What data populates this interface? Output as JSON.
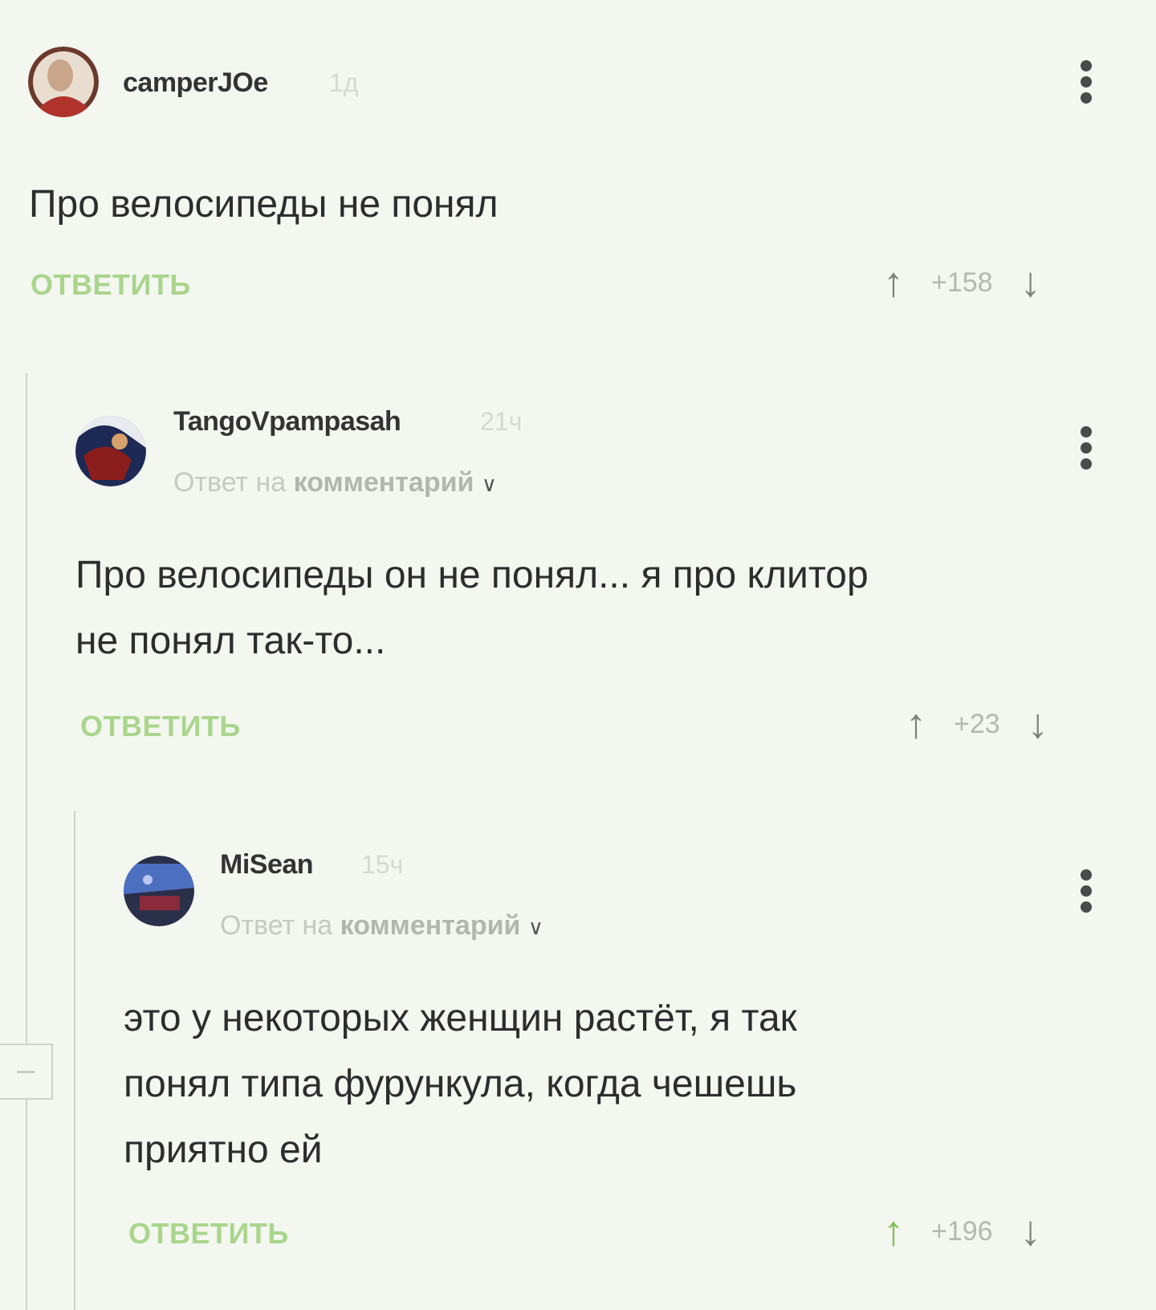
{
  "comments": [
    {
      "username": "camperJOe",
      "time": "1д",
      "text": "Про велосипеды не понял",
      "reply_label": "ОТВЕТИТЬ",
      "score": "+158",
      "avatar_icon": "user-avatar"
    },
    {
      "username": "TangoVpampasah",
      "time": "21ч",
      "reply_to_prefix": "Ответ на",
      "reply_to_target": "комментарий",
      "text_line1": "Про велосипеды он не понял... я про клитор",
      "text_line2": "не понял так-то...",
      "reply_label": "ОТВЕТИТЬ",
      "score": "+23",
      "avatar_icon": "user-avatar"
    },
    {
      "username": "MiSean",
      "time": "15ч",
      "reply_to_prefix": "Ответ на",
      "reply_to_target": "комментарий",
      "text_line1": "это у некоторых женщин растёт, я так",
      "text_line2": "понял типа фурункула, когда чешешь",
      "text_line3": "приятно ей",
      "reply_label": "ОТВЕТИТЬ",
      "score": "+196",
      "avatar_icon": "user-avatar"
    }
  ],
  "colors": {
    "background": "#f4f6f0",
    "reply_green": "#a9d68c",
    "thread_line": "#cfd2cc"
  }
}
